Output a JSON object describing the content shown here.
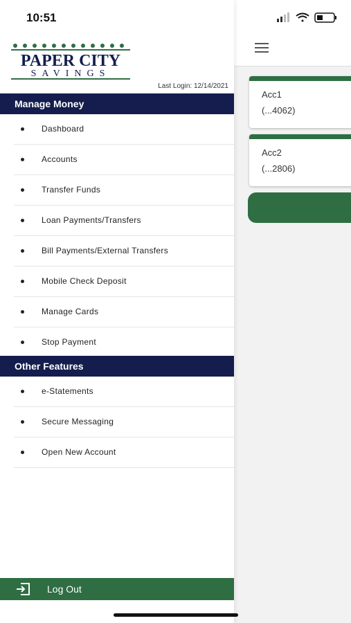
{
  "status_bar": {
    "time": "10:51"
  },
  "drawer": {
    "logo": {
      "line1": "PAPER CITY",
      "line2": "SAVINGS"
    },
    "last_login": "Last Login:  12/14/2021",
    "sections": [
      {
        "title": "Manage Money",
        "items": [
          "Dashboard",
          "Accounts",
          "Transfer Funds",
          "Loan Payments/Transfers",
          "Bill Payments/External Transfers",
          "Mobile Check Deposit",
          "Manage Cards",
          "Stop Payment"
        ]
      },
      {
        "title": "Other Features",
        "items": [
          "e-Statements",
          "Secure Messaging",
          "Open New Account"
        ]
      }
    ],
    "logout_label": "Log Out"
  },
  "accounts": [
    {
      "name": "Acc1",
      "number": "(...4062)"
    },
    {
      "name": "Acc2",
      "number": "(...2806)"
    }
  ],
  "colors": {
    "navy": "#141d4e",
    "green": "#2f6e43"
  }
}
